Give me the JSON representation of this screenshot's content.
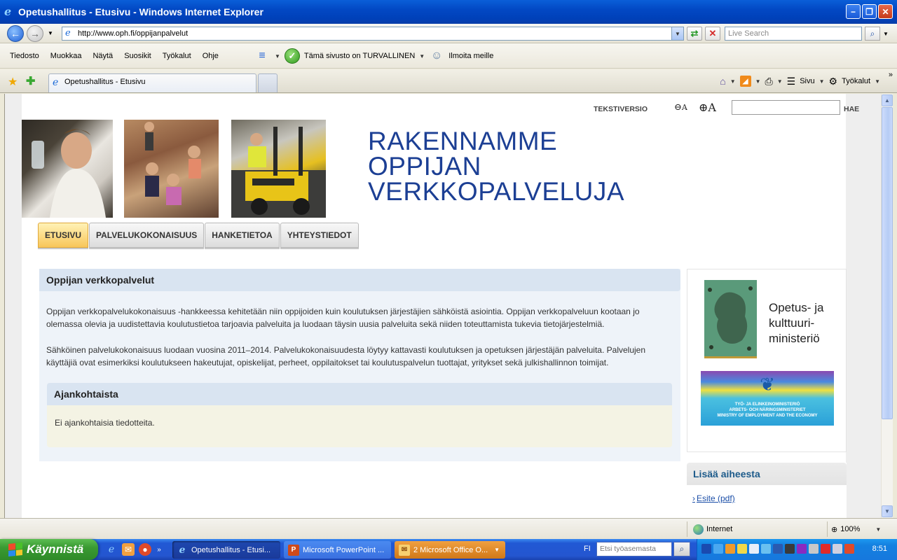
{
  "window": {
    "title": "Opetushallitus - Etusivu - Windows Internet Explorer"
  },
  "addressbar": {
    "url": "http://www.oph.fi/oppijanpalvelut",
    "search_placeholder": "Live Search"
  },
  "menu": {
    "items": [
      "Tiedosto",
      "Muokkaa",
      "Näytä",
      "Suosikit",
      "Työkalut",
      "Ohje"
    ]
  },
  "toolbar": {
    "safety_text": "Tämä sivusto on TURVALLINEN",
    "report_text": "Ilmoita meille"
  },
  "tabs": {
    "active_title": "Opetushallitus - Etusivu"
  },
  "commandbar": {
    "page_label": "Sivu",
    "tools_label": "Työkalut"
  },
  "page": {
    "text_version": "TEKSTIVERSIO",
    "zoom_out": "A",
    "zoom_in": "A",
    "search_button": "HAE",
    "headline": [
      "RAKENNAMME",
      "OPPIJAN",
      "VERKKOPALVELUJA"
    ],
    "nav": [
      "ETUSIVU",
      "PALVELUKOKONAISUUS",
      "HANKETIETOA",
      "YHTEYSTIEDOT"
    ],
    "main": {
      "title": "Oppijan verkkopalvelut",
      "para1": "Oppijan verkkopalvelukokonaisuus -hankkeessa kehitetään niin oppijoiden kuin koulutuksen järjestäjien sähköistä asiointia. Oppijan verkkopalveluun kootaan jo olemassa olevia ja uudistettavia koulutustietoa tarjoavia palveluita ja luodaan täysin uusia palveluita sekä niiden toteuttamista tukevia tietojärjestelmiä.",
      "para2": "Sähköinen palvelukokonaisuus luodaan vuosina 2011–2014.  Palvelukokonaisuudesta löytyy kattavasti koulutuksen ja opetuksen järjestäjän palveluita. Palvelujen käyttäjiä ovat esimerkiksi koulutukseen hakeutujat, opiskelijat, perheet, oppilaitokset tai koulutuspalvelun tuottajat, yritykset sekä julkishallinnon toimijat.",
      "news_title": "Ajankohtaista",
      "news_body": "Ei ajankohtaisia tiedotteita."
    },
    "sidebar": {
      "okm_lines": [
        "Opetus- ja",
        "kulttuuri-",
        "ministeriö"
      ],
      "tem_lines": [
        "TYÖ- JA ELINKEINOMINISTERIÖ",
        "ARBETS- OCH NÄRINGSMINISTERIET",
        "MINISTRY OF EMPLOYMENT AND THE ECONOMY"
      ],
      "more_title": "Lisää aiheesta",
      "more_link": "Esite (pdf)"
    }
  },
  "statusbar": {
    "zone": "Internet",
    "zoom": "100%"
  },
  "taskbar": {
    "start": "Käynnistä",
    "tasks": [
      "Opetushallitus - Etusi...",
      "Microsoft PowerPoint ...",
      "2 Microsoft Office O..."
    ],
    "lang": "FI",
    "search_placeholder": "Etsi työasemasta",
    "clock": "8:51"
  }
}
